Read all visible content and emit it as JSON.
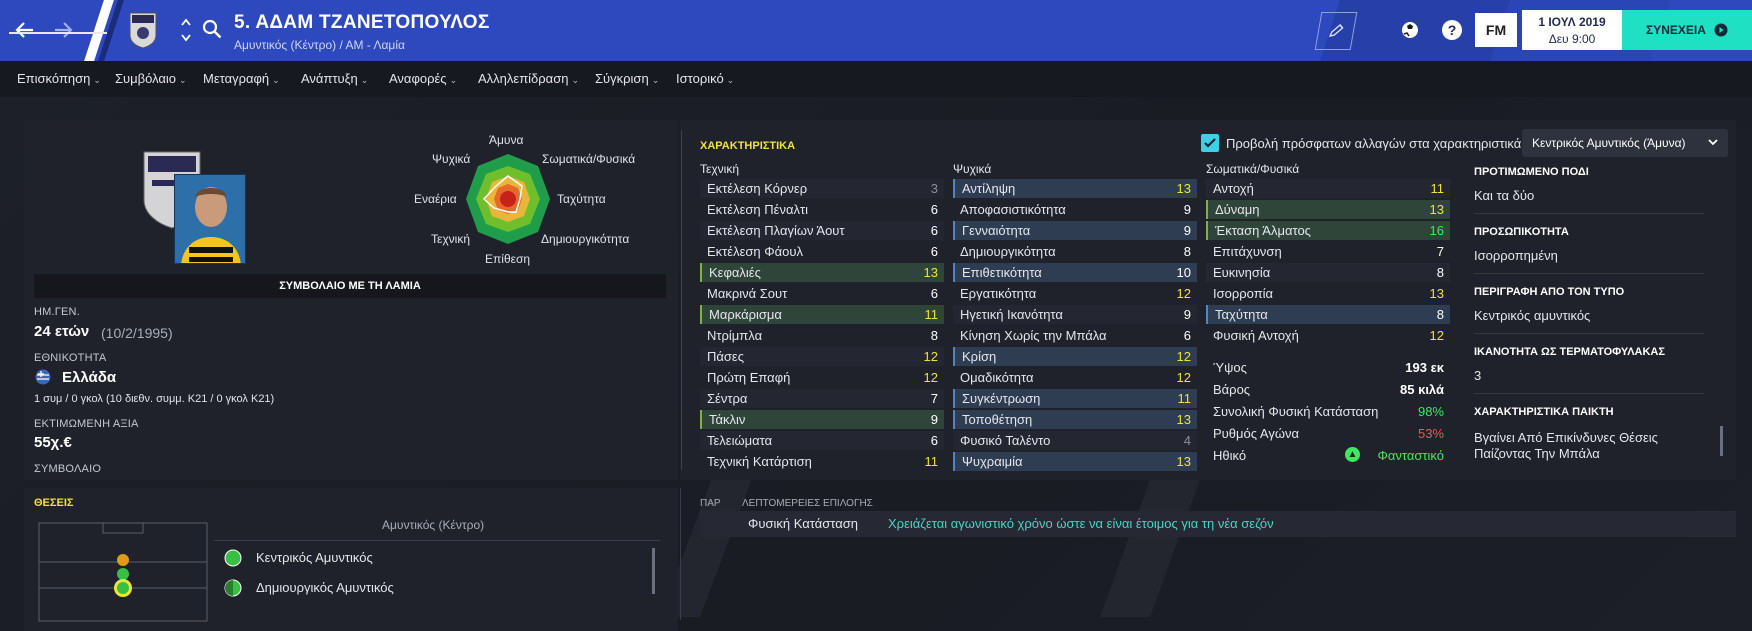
{
  "header": {
    "title": "5. ΑΔΑΜ ΤΖΑΝΕΤΟΠΟΥΛΟΣ",
    "subtitle": "Αμυντικός (Κέντρο) / ΑΜ - Λαμία",
    "date": "1 ΙΟΥΛ 2019",
    "time": "Δευ 9:00",
    "continue_label": "ΣΥΝΕΧΕΙΑ",
    "fm_label": "FM",
    "help_label": "?"
  },
  "menu": {
    "items": [
      "Επισκόπηση",
      "Συμβόλαιο",
      "Μεταγραφή",
      "Ανάπτυξη",
      "Αναφορές",
      "Αλληλεπίδραση",
      "Σύγκριση",
      "Ιστορικό"
    ]
  },
  "profile": {
    "contract_banner": "ΣΥΜΒΟΛΑΙΟ ΜΕ ΤΗ ΛΑΜΙΑ",
    "dob_label": "ΗΜ.ΓΕΝ.",
    "age": "24 ετών",
    "dob": "(10/2/1995)",
    "nationality_label": "ΕΘΝΙΚΟΤΗΤΑ",
    "nationality": "Ελλάδα",
    "caps": "1 συμ / 0 γκολ (10 διεθν. συμμ. Κ21 / 0 γκολ Κ21)",
    "value_label": "ΕΚΤΙΜΩΜΕΝΗ ΑΞΙΑ",
    "value": "55χ.€",
    "contract_label": "ΣΥΜΒΟΛΑΙΟ"
  },
  "radar": {
    "labels": {
      "top": "Άμυνα",
      "topright": "Σωματικά/Φυσικά",
      "right": "Ταχύτητα",
      "bottomright": "Δημιουργικότητα",
      "bottom": "Επίθεση",
      "bottomleft": "Τεχνική",
      "left": "Εναέρια",
      "topleft": "Ψυχικά"
    }
  },
  "attributes": {
    "title": "ΧΑΡΑΚΤΗΡΙΣΤΙΚΑ",
    "checkbox_label": "Προβολή πρόσφατων αλλαγών στα χαρακτηριστικά",
    "role_select": "Κεντρικός Αμυντικός (Άμυνα)",
    "technical_header": "Τεχνική",
    "mental_header": "Ψυχικά",
    "physical_header": "Σωματικά/Φυσικά",
    "technical": [
      {
        "name": "Εκτέλεση Κόρνερ",
        "value": "3"
      },
      {
        "name": "Εκτέλεση Πέναλτι",
        "value": "6"
      },
      {
        "name": "Εκτέλεση Πλαγίων Άουτ",
        "value": "6"
      },
      {
        "name": "Εκτέλεση Φάουλ",
        "value": "6"
      },
      {
        "name": "Κεφαλιές",
        "value": "13"
      },
      {
        "name": "Μακρινά Σουτ",
        "value": "6"
      },
      {
        "name": "Μαρκάρισμα",
        "value": "11"
      },
      {
        "name": "Ντρίμπλα",
        "value": "8"
      },
      {
        "name": "Πάσες",
        "value": "12"
      },
      {
        "name": "Πρώτη Επαφή",
        "value": "12"
      },
      {
        "name": "Σέντρα",
        "value": "7"
      },
      {
        "name": "Τάκλιν",
        "value": "9"
      },
      {
        "name": "Τελειώματα",
        "value": "6"
      },
      {
        "name": "Τεχνική Κατάρτιση",
        "value": "11"
      }
    ],
    "mental": [
      {
        "name": "Αντίληψη",
        "value": "13"
      },
      {
        "name": "Αποφασιστικότητα",
        "value": "9"
      },
      {
        "name": "Γενναιότητα",
        "value": "9"
      },
      {
        "name": "Δημιουργικότητα",
        "value": "8"
      },
      {
        "name": "Επιθετικότητα",
        "value": "10"
      },
      {
        "name": "Εργατικότητα",
        "value": "12"
      },
      {
        "name": "Ηγετική Ικανότητα",
        "value": "9"
      },
      {
        "name": "Κίνηση Χωρίς την Μπάλα",
        "value": "6"
      },
      {
        "name": "Κρίση",
        "value": "12"
      },
      {
        "name": "Ομαδικότητα",
        "value": "12"
      },
      {
        "name": "Συγκέντρωση",
        "value": "11"
      },
      {
        "name": "Τοποθέτηση",
        "value": "13"
      },
      {
        "name": "Φυσικό Ταλέντο",
        "value": "4"
      },
      {
        "name": "Ψυχραιμία",
        "value": "13"
      }
    ],
    "physical": [
      {
        "name": "Αντοχή",
        "value": "11"
      },
      {
        "name": "Δύναμη",
        "value": "13"
      },
      {
        "name": "Έκταση Άλματος",
        "value": "16"
      },
      {
        "name": "Επιτάχυνση",
        "value": "7"
      },
      {
        "name": "Ευκινησία",
        "value": "8"
      },
      {
        "name": "Ισορροπία",
        "value": "13"
      },
      {
        "name": "Ταχύτητα",
        "value": "8"
      },
      {
        "name": "Φυσική Αντοχή",
        "value": "12"
      }
    ],
    "extras": [
      {
        "name": "Ύψος",
        "value": "193 εκ"
      },
      {
        "name": "Βάρος",
        "value": "85 κιλά"
      },
      {
        "name": "Συνολική Φυσική Κατάσταση",
        "value": "98%"
      },
      {
        "name": "Ρυθμός Αγώνα",
        "value": "53%"
      },
      {
        "name": "Ηθικό",
        "value": "Φανταστικό"
      }
    ]
  },
  "side": {
    "foot_label": "ΠΡΟΤΙΜΩΜΕΝΟ ΠΟΔΙ",
    "foot": "Και τα δύο",
    "personality_label": "ΠΡΟΣΩΠΙΚΟΤΗΤΑ",
    "personality": "Ισορροπημένη",
    "media_label": "ΠΕΡΙΓΡΑΦΗ ΑΠΟ ΤΟΝ ΤΥΠΟ",
    "media": "Κεντρικός αμυντικός",
    "gk_label": "ΙΚΑΝΟΤΗΤΑ ΩΣ ΤΕΡΜΑΤΟΦΥΛΑΚΑΣ",
    "gk": "3",
    "traits_label": "ΧΑΡΑΚΤΗΡΙΣΤΙΚΑ ΠΑΙΚΤΗ",
    "traits": "Βγαίνει Από Επικίνδυνες Θέσεις Παίζοντας Την Μπάλα"
  },
  "positions": {
    "title": "ΘΕΣΕΙΣ",
    "current": "Αμυντικός (Κέντρο)",
    "roles": [
      "Κεντρικός Αμυντικός",
      "Δημιουργικός Αμυντικός"
    ]
  },
  "selection": {
    "col1": "ΠΑΡ",
    "col2": "ΛΕΠΤΟΜΕΡΕΙΕΣ ΕΠΙΛΟΓΗΣ",
    "item_label": "Φυσική Κατάσταση",
    "item_text": "Χρειάζεται αγωνιστικό χρόνο ώστε να είναι έτοιμος για τη νέα σεζόν"
  },
  "colors": {
    "header": "#2d49bd",
    "continue": "#1fe0c2",
    "highlight_yellow": "#f0e23a",
    "good_green": "#3ee860",
    "bad_red": "#e85a5a",
    "selection_text": "#43d6c4"
  }
}
